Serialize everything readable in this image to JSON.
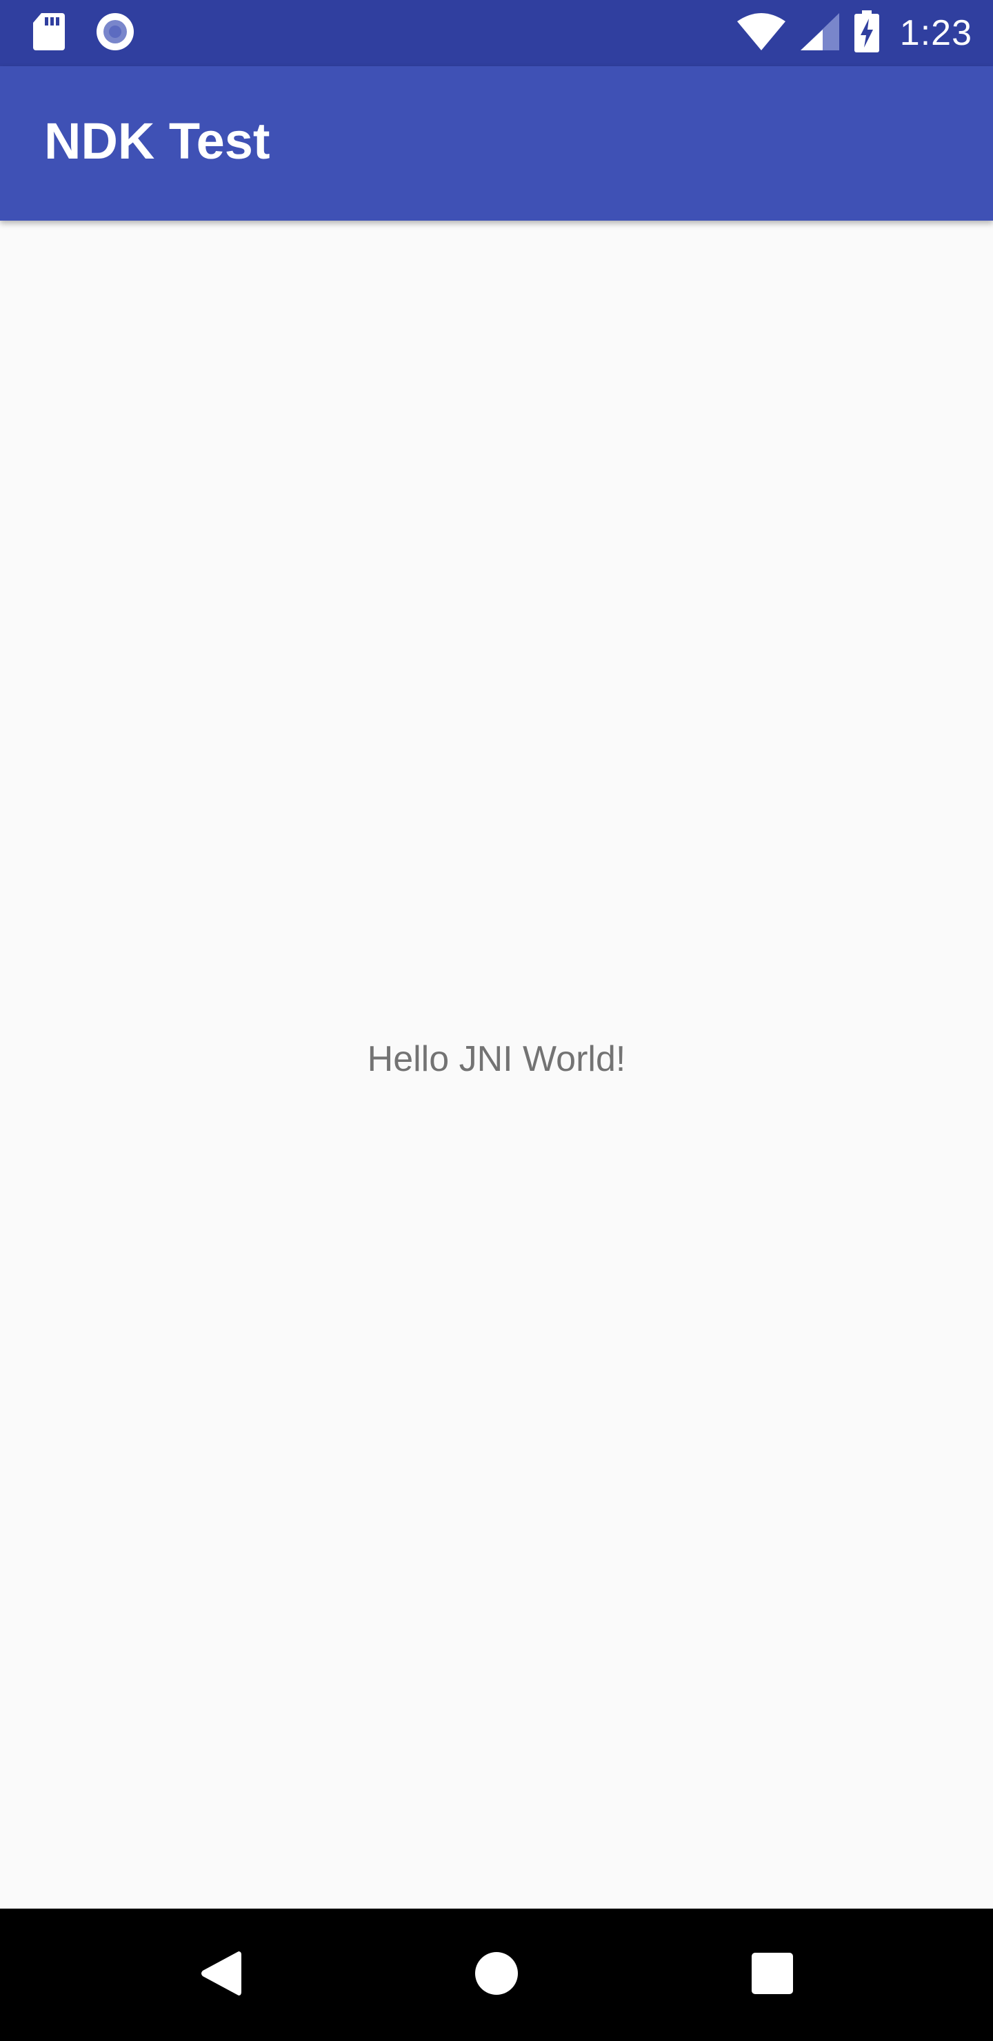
{
  "status_bar": {
    "time": "1:23",
    "background_color": "#303f9f",
    "left_icons": [
      "sd-card-icon",
      "record-icon"
    ],
    "right_icons": [
      "wifi-icon",
      "cell-signal-icon",
      "battery-charging-icon"
    ]
  },
  "app_bar": {
    "title": "NDK Test",
    "background_color": "#3f51b5"
  },
  "main": {
    "message": "Hello JNI World!"
  },
  "nav_bar": {
    "buttons": [
      "back-icon",
      "home-icon",
      "recents-icon"
    ]
  }
}
